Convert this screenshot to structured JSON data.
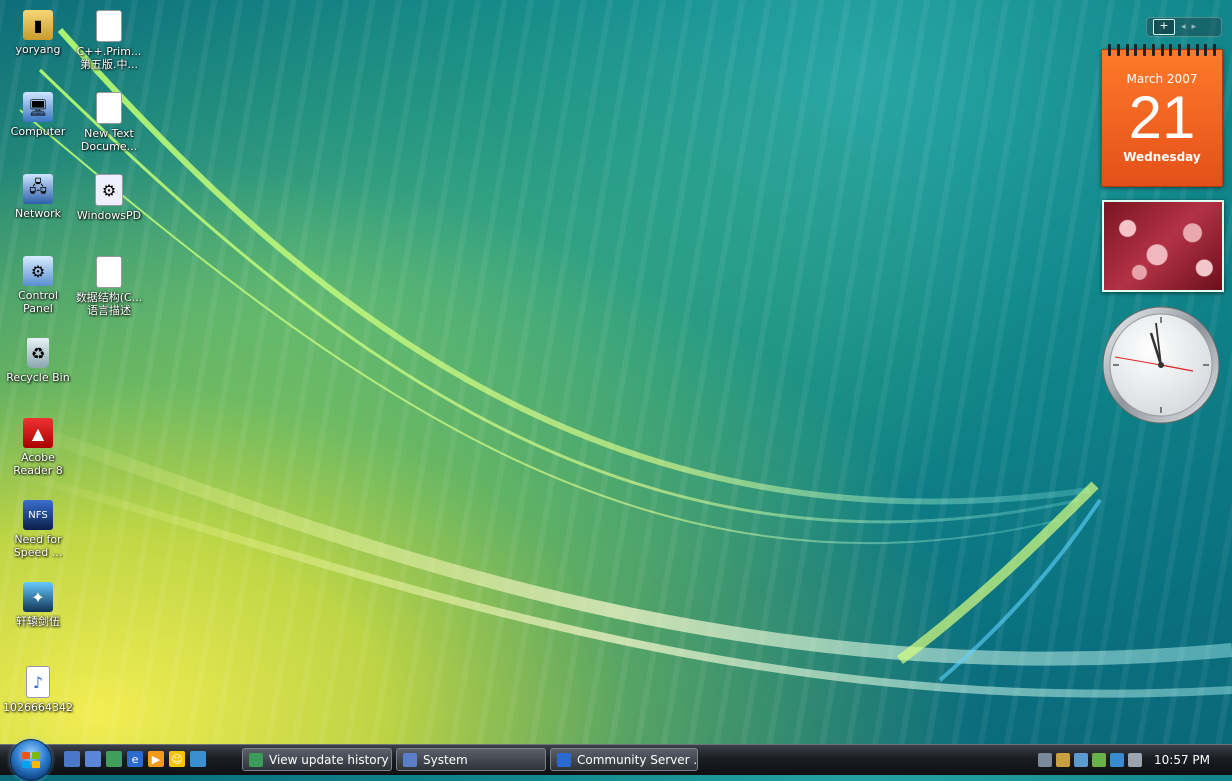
{
  "desktop": {
    "icons": [
      {
        "label": "yoryang",
        "icon": "user-folder-icon"
      },
      {
        "label": "C++.Prim...\n第五版.中...",
        "icon": "document-icon"
      },
      {
        "label": "Computer",
        "icon": "computer-icon"
      },
      {
        "label": "New Text\nDocume...",
        "icon": "text-document-icon"
      },
      {
        "label": "Network",
        "icon": "network-icon"
      },
      {
        "label": "WindowsPD",
        "icon": "settings-document-icon"
      },
      {
        "label": "Control\nPanel",
        "icon": "control-panel-icon"
      },
      {
        "label": "数据结构(C...\n语言描述",
        "icon": "document-icon"
      },
      {
        "label": "Recycle Bin",
        "icon": "recycle-bin-icon"
      },
      {
        "label": "Acobe\nReader 8",
        "icon": "adobe-reader-icon"
      },
      {
        "label": "Need for\nSpeed ...",
        "icon": "game-icon"
      },
      {
        "label": "轩辕剑伍",
        "icon": "game-icon"
      },
      {
        "label": "1026664342",
        "icon": "wma-audio-icon"
      }
    ]
  },
  "sidebar": {
    "add_label": "+",
    "prev_label": "◂",
    "next_label": "▸",
    "calendar": {
      "month": "March 2007",
      "day": "21",
      "weekday": "Wednesday"
    }
  },
  "taskbar": {
    "start_label": "Start",
    "quick_launch": [
      "show-desktop-icon",
      "switch-windows-icon",
      "media-icon",
      "internet-explorer-icon",
      "media-player-icon",
      "messenger-icon",
      "people-icon"
    ],
    "buttons": [
      {
        "label": "View update history"
      },
      {
        "label": "System"
      },
      {
        "label": "Community Server ..."
      }
    ],
    "clock": "10:57 PM"
  },
  "colors": {
    "calendar_bg": "#e85a1c",
    "taskbar_bg": "#1a1d22",
    "wallpaper_teal": "#10868a",
    "wallpaper_yellow": "#f4f04a"
  }
}
